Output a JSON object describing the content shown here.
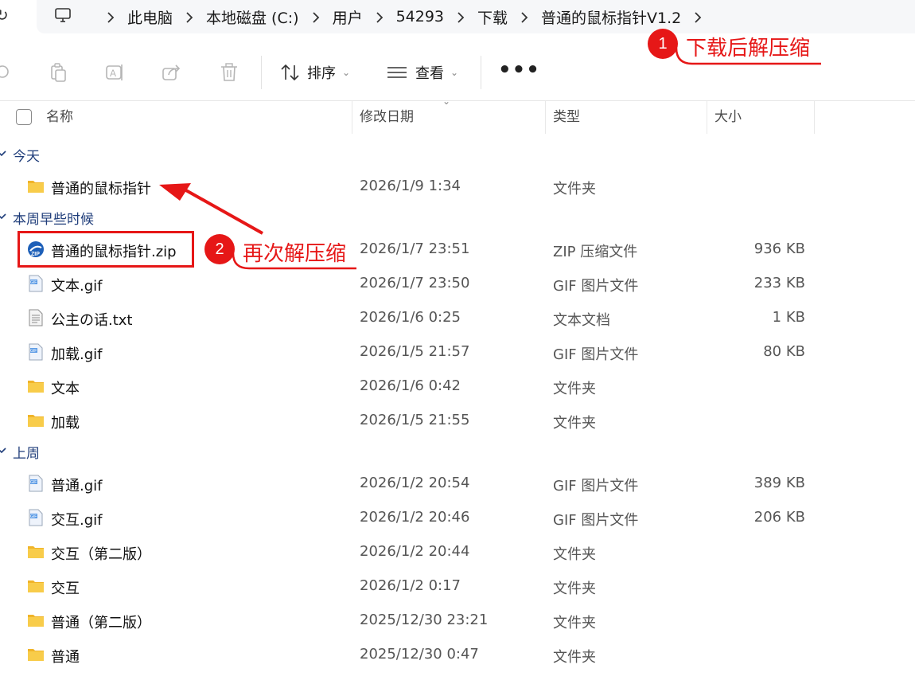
{
  "address_bar": {
    "crumbs": [
      "此电脑",
      "本地磁盘 (C:)",
      "用户",
      "54293",
      "下载",
      "普通的鼠标指针V1.2"
    ]
  },
  "toolbar": {
    "sort_label": "排序",
    "view_label": "查看",
    "more_label": "•••"
  },
  "header": {
    "name": "名称",
    "date": "修改日期",
    "type": "类型",
    "size": "大小"
  },
  "groups": {
    "today": "今天",
    "earlier_this_week": "本周早些时候",
    "last_week": "上周"
  },
  "files": [
    {
      "name": "普通的鼠标指针",
      "date": "2026/1/9 1:34",
      "type": "文件夹",
      "size": "",
      "icon": "folder-icon"
    },
    {
      "name": "普通的鼠标指针.zip",
      "date": "2026/1/7 23:51",
      "type": "ZIP 压缩文件",
      "size": "936 KB",
      "icon": "zip-icon"
    },
    {
      "name": "文本.gif",
      "date": "2026/1/7 23:50",
      "type": "GIF 图片文件",
      "size": "233 KB",
      "icon": "gif-icon"
    },
    {
      "name": "公主の话.txt",
      "date": "2026/1/6 0:25",
      "type": "文本文档",
      "size": "1 KB",
      "icon": "txt-icon"
    },
    {
      "name": "加载.gif",
      "date": "2026/1/5 21:57",
      "type": "GIF 图片文件",
      "size": "80 KB",
      "icon": "gif-icon"
    },
    {
      "name": "文本",
      "date": "2026/1/6 0:42",
      "type": "文件夹",
      "size": "",
      "icon": "folder-icon"
    },
    {
      "name": "加载",
      "date": "2026/1/5 21:55",
      "type": "文件夹",
      "size": "",
      "icon": "folder-icon"
    },
    {
      "name": "普通.gif",
      "date": "2026/1/2 20:54",
      "type": "GIF 图片文件",
      "size": "389 KB",
      "icon": "gif-icon"
    },
    {
      "name": "交互.gif",
      "date": "2026/1/2 20:46",
      "type": "GIF 图片文件",
      "size": "206 KB",
      "icon": "gif-icon"
    },
    {
      "name": "交互（第二版）",
      "date": "2026/1/2 20:44",
      "type": "文件夹",
      "size": "",
      "icon": "folder-icon"
    },
    {
      "name": "交互",
      "date": "2026/1/2 0:17",
      "type": "文件夹",
      "size": "",
      "icon": "folder-icon"
    },
    {
      "name": "普通（第二版）",
      "date": "2025/12/30 23:21",
      "type": "文件夹",
      "size": "",
      "icon": "folder-icon"
    },
    {
      "name": "普通",
      "date": "2025/12/30 0:47",
      "type": "文件夹",
      "size": "",
      "icon": "folder-icon"
    }
  ],
  "annotations": {
    "step1_number": "1",
    "step1_text": "下载后解压缩",
    "step2_number": "2",
    "step2_text": "再次解压缩"
  },
  "colors": {
    "annotation_red": "#e61717",
    "group_header_blue": "#1f3d7a",
    "folder_yellow": "#f5c542"
  }
}
